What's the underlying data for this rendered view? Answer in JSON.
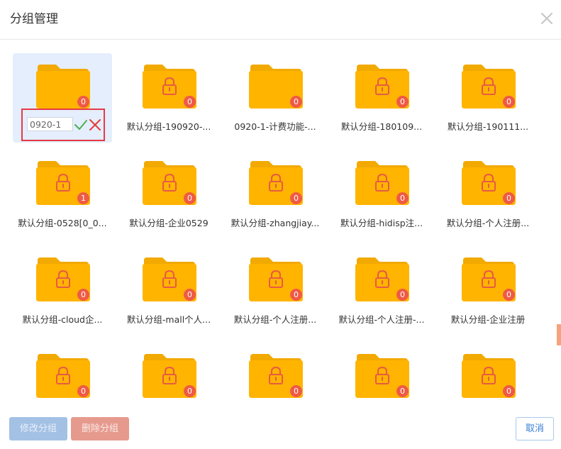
{
  "dialog": {
    "title": "分组管理",
    "close_icon": "close-icon"
  },
  "colors": {
    "folder": "#ffb400",
    "folder_back": "#f2a900",
    "lock": "#e85a44",
    "badge": "#ef5a45",
    "selected_bg": "#e4eefc",
    "highlight_border": "#e63946",
    "confirm": "#4caf50",
    "cancel": "#e53935"
  },
  "editing": {
    "input_value": "0920-1",
    "confirm_icon": "check-icon",
    "cancel_icon": "x-icon"
  },
  "groups": [
    {
      "label": "",
      "count": "0",
      "locked": false,
      "editing": true
    },
    {
      "label": "默认分组-190920-...",
      "count": "0",
      "locked": true
    },
    {
      "label": "0920-1-计费功能-...",
      "count": "0",
      "locked": false
    },
    {
      "label": "默认分组-180109...",
      "count": "0",
      "locked": true
    },
    {
      "label": "默认分组-190111...",
      "count": "0",
      "locked": true
    },
    {
      "label": "默认分组-0528[0_0...",
      "count": "1",
      "locked": true
    },
    {
      "label": "默认分组-企业0529",
      "count": "0",
      "locked": true
    },
    {
      "label": "默认分组-zhangjiay...",
      "count": "0",
      "locked": true
    },
    {
      "label": "默认分组-hidisp注...",
      "count": "0",
      "locked": true
    },
    {
      "label": "默认分组-个人注册...",
      "count": "0",
      "locked": true
    },
    {
      "label": "默认分组-cloud企...",
      "count": "0",
      "locked": true
    },
    {
      "label": "默认分组-mall个人...",
      "count": "0",
      "locked": true
    },
    {
      "label": "默认分组-个人注册...",
      "count": "0",
      "locked": true
    },
    {
      "label": "默认分组-个人注册-...",
      "count": "0",
      "locked": true
    },
    {
      "label": "默认分组-企业注册",
      "count": "0",
      "locked": true
    },
    {
      "label": "",
      "count": "0",
      "locked": true
    },
    {
      "label": "",
      "count": "0",
      "locked": true
    },
    {
      "label": "",
      "count": "0",
      "locked": true
    },
    {
      "label": "",
      "count": "0",
      "locked": true
    },
    {
      "label": "",
      "count": "0",
      "locked": true
    }
  ],
  "footer": {
    "modify_label": "修改分组",
    "delete_label": "删除分组",
    "cancel_label": "取消"
  }
}
